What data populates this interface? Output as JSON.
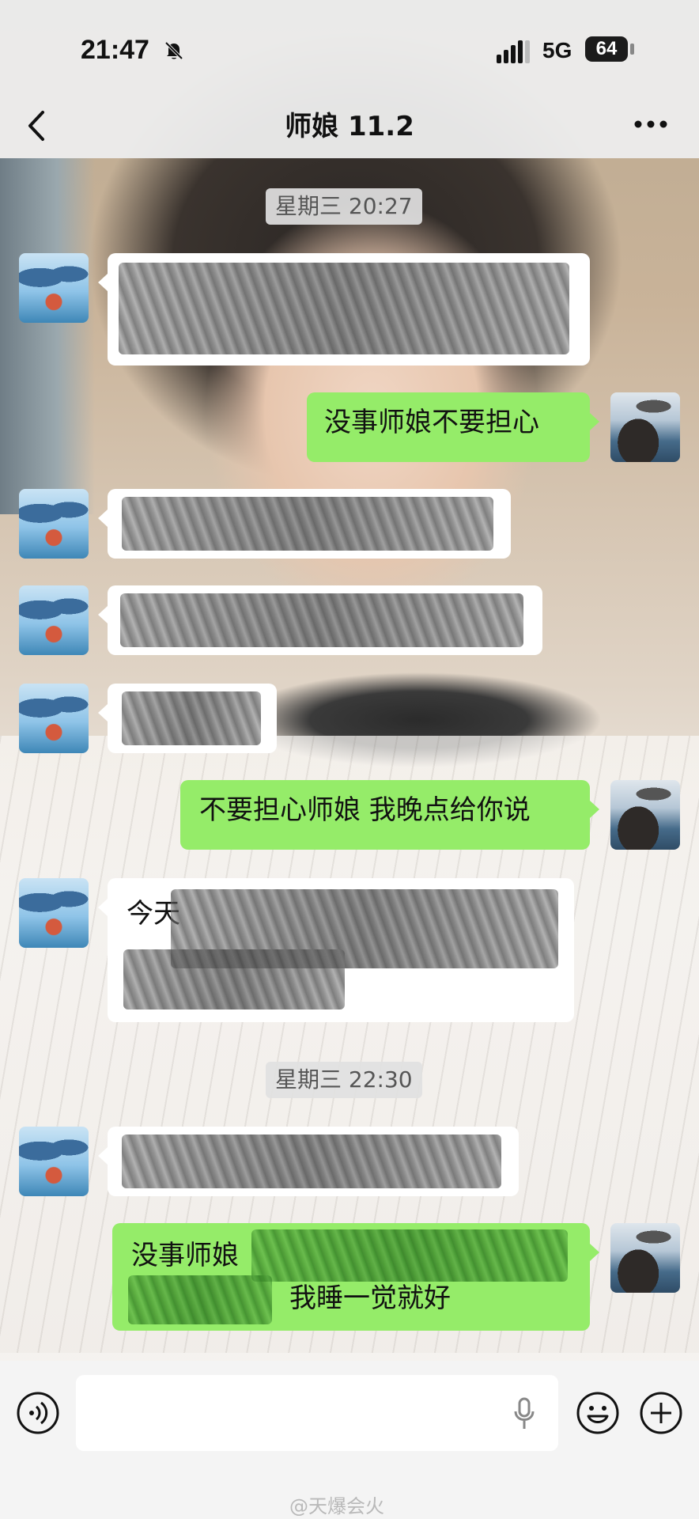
{
  "status_bar": {
    "time": "21:47",
    "network": "5G",
    "battery": "64"
  },
  "nav": {
    "title": "师娘 11.2"
  },
  "timestamps": [
    "星期三 20:27",
    "星期三 22:30"
  ],
  "messages": [
    {
      "side": "in",
      "text": ""
    },
    {
      "side": "out",
      "text": "没事师娘不要担心"
    },
    {
      "side": "in",
      "text": ""
    },
    {
      "side": "in",
      "text": ""
    },
    {
      "side": "in",
      "text": ""
    },
    {
      "side": "out",
      "text": "不要担心师娘 我晚点给你说"
    },
    {
      "side": "in",
      "text": "今天"
    },
    {
      "side": "in",
      "text": ""
    },
    {
      "side": "out",
      "text_line1": "没事师娘",
      "text_line2": "我睡一觉就好"
    }
  ],
  "watermark": "@天爆会火",
  "icons": [
    "bell-off-icon",
    "signal-icon",
    "back-icon",
    "more-icon",
    "voice-icon",
    "mic-icon",
    "emoji-icon",
    "plus-icon"
  ]
}
